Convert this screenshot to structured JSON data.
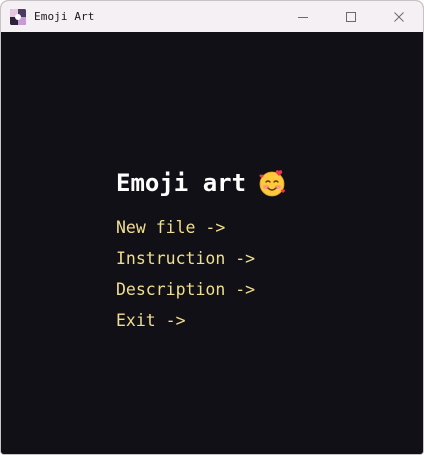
{
  "window": {
    "title": "Emoji Art",
    "controls": {
      "minimize": "minimize-icon",
      "maximize": "maximize-icon",
      "close": "close-icon"
    }
  },
  "main": {
    "heading": "Emoji art",
    "heading_emoji": "smiling-face-with-hearts-icon",
    "menu": [
      {
        "label": "New file ->"
      },
      {
        "label": "Instruction ->"
      },
      {
        "label": "Description ->"
      },
      {
        "label": "Exit ->"
      }
    ]
  },
  "colors": {
    "background": "#111016",
    "titlebar": "#f4f0f3",
    "heading": "#ffffff",
    "menu_text": "#f0de8e"
  }
}
